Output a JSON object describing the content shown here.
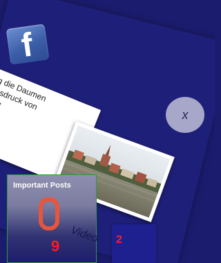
{
  "colors": {
    "background": "#1b1c6e",
    "panel": "#1e1f78",
    "facebook_blue": "#3b5ea8",
    "tile_border": "#2f9a3f",
    "count_red": "#ff1a1a"
  },
  "facebook_post": {
    "logo_icon": "facebook-logo-icon",
    "logo_glyph": "f",
    "text_lines": [
      "burg die Daumen",
      "Ausdruck von",
      "schung"
    ],
    "close_label": "x",
    "photo_icon": "flood-town-photo"
  },
  "important_posts": {
    "title": "Important Posts",
    "icon": "padlock-shackle-icon",
    "count": "9"
  },
  "videos": {
    "label": "Video",
    "count": "2"
  }
}
